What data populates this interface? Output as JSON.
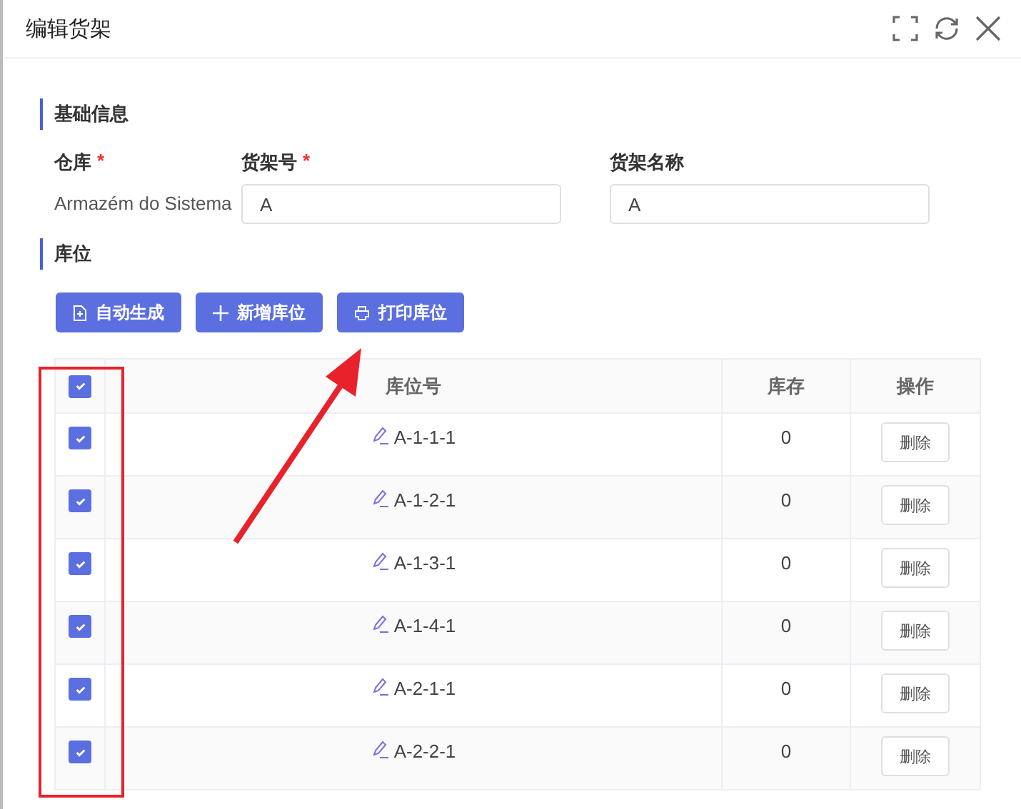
{
  "window": {
    "title": "编辑货架"
  },
  "sections": [
    {
      "title": "基础信息"
    },
    {
      "title": "库位"
    }
  ],
  "fields": [
    {
      "label": "仓库",
      "required_mark": "*",
      "kind": "text",
      "value": "Armazém do Sistema"
    },
    {
      "label": "货架号",
      "required_mark": "*",
      "kind": "input",
      "value": "A"
    },
    {
      "label": "货架名称",
      "kind": "input",
      "value": "A"
    }
  ],
  "buttons": [
    {
      "label": "自动生成"
    },
    {
      "label": "新增库位"
    },
    {
      "label": "打印库位"
    }
  ],
  "table": {
    "header_checked": true,
    "columns": [
      "库位号",
      "库存",
      "操作"
    ],
    "rows": [
      {
        "checked": true,
        "code": "A-1-1-1",
        "stock": "0",
        "action": "删除"
      },
      {
        "checked": true,
        "code": "A-1-2-1",
        "stock": "0",
        "action": "删除"
      },
      {
        "checked": true,
        "code": "A-1-3-1",
        "stock": "0",
        "action": "删除"
      },
      {
        "checked": true,
        "code": "A-1-4-1",
        "stock": "0",
        "action": "删除"
      },
      {
        "checked": true,
        "code": "A-2-1-1",
        "stock": "0",
        "action": "删除"
      },
      {
        "checked": true,
        "code": "A-2-2-1",
        "stock": "0",
        "action": "删除"
      }
    ]
  }
}
